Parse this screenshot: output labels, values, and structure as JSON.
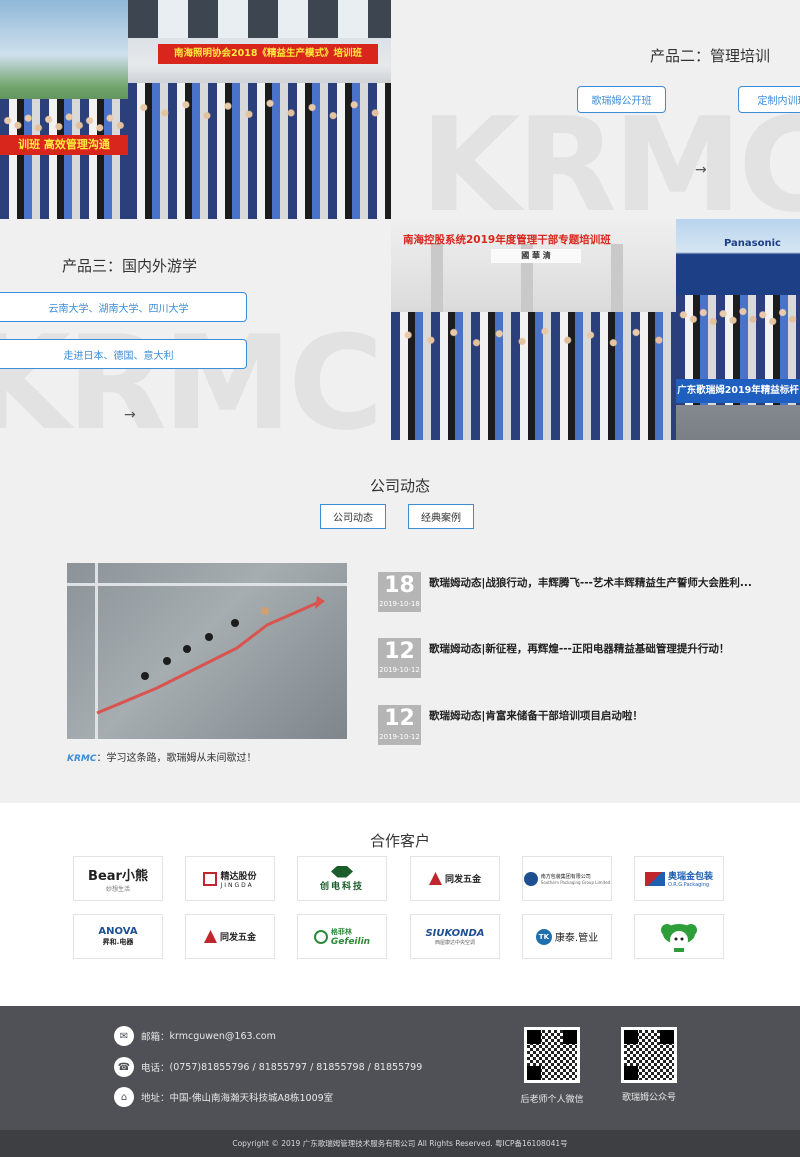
{
  "products": {
    "p2": {
      "title": "产品二：管理培训",
      "buttons": [
        "歌瑞姆公开班",
        "定制内训班"
      ]
    },
    "p3": {
      "title": "产品三：国内外游学",
      "buttons": [
        "云南大学、湖南大学、四川大学",
        "走进日本、德国、意大利"
      ]
    },
    "arrow": "→",
    "photos": {
      "left_banner": "训班  高效管理沟通",
      "top_banner": "南海照明协会2018《精益生产模式》培训班",
      "mid_banner": "南海控股系统2019年度管理干部专题培训班",
      "mid_plaque": "國 華 清",
      "right_brand": "Panasonic",
      "right_banner": "广东歌瑞姆2019年精益标杆"
    }
  },
  "news": {
    "title": "公司动态",
    "tabs": [
      "公司动态",
      "经典案例"
    ],
    "caption_logo": "KRMC",
    "caption": "：学习这条路，歌瑞姆从未间歇过！",
    "items": [
      {
        "day": "18",
        "date": "2019-10-18",
        "title": "歌瑞姆动态|战狼行动，丰辉腾飞---艺术丰辉精益生产誓师大会胜利..."
      },
      {
        "day": "12",
        "date": "2019-10-12",
        "title": "歌瑞姆动态|新征程，再辉煌---正阳电器精益基础管理提升行动！"
      },
      {
        "day": "12",
        "date": "2019-10-12",
        "title": "歌瑞姆动态|肯富来储备干部培训项目启动啦！"
      }
    ]
  },
  "partners": {
    "title": "合作客户",
    "logos": [
      {
        "main": "Bear小熊",
        "sub": "妙想生活",
        "color": "#222222"
      },
      {
        "main": "精达股份",
        "sub": "JINGDA",
        "color": "#c0262d"
      },
      {
        "main": "创电科技",
        "sub": "",
        "color": "#1a5c2a"
      },
      {
        "main": "同发五金",
        "sub": "",
        "color": "#c0262d"
      },
      {
        "main": "南方包装集团有限公司",
        "sub": "Southern Packaging Group Limited",
        "color": "#1d4f91"
      },
      {
        "main": "奥瑞金包装",
        "sub": "O.R.G.Packaging",
        "color": "#1d5fb0"
      },
      {
        "main": "ANOVA",
        "sub": "昇和.电器",
        "color": "#1d4f91"
      },
      {
        "main": "同发五金",
        "sub": "",
        "color": "#c0262d"
      },
      {
        "main": "格菲林",
        "sub": "Gefeilin",
        "color": "#2e8b3a"
      },
      {
        "main": "SIUKONDA",
        "sub": "西屋康达中央空调",
        "color": "#1d4f91"
      },
      {
        "main": "康泰.管业",
        "sub": "",
        "color": "#1d6fb0"
      },
      {
        "main": "",
        "sub": "",
        "color": "#2e9e3a"
      }
    ]
  },
  "footer": {
    "email_label": "邮箱：",
    "email": "krmcguwen@163.com",
    "phone_label": "电话：",
    "phone": "(0757)81855796 / 81855797 / 81855798 / 81855799",
    "address_label": "地址：",
    "address": "中国-佛山南海瀚天科技城A8栋1009室",
    "qr1_caption": "后老师个人微信",
    "qr2_caption": "歌瑞姆公众号",
    "copyright": "Copyright © 2019 广东歌瑞姆管理技术服务有限公司 All Rights Reserved.  粤ICP备16108041号"
  },
  "colors": {
    "accent": "#3c8dd8",
    "footer_bg": "#4f5156",
    "footer_bottom": "#3e3f43",
    "date_box": "#b5b5b5"
  }
}
